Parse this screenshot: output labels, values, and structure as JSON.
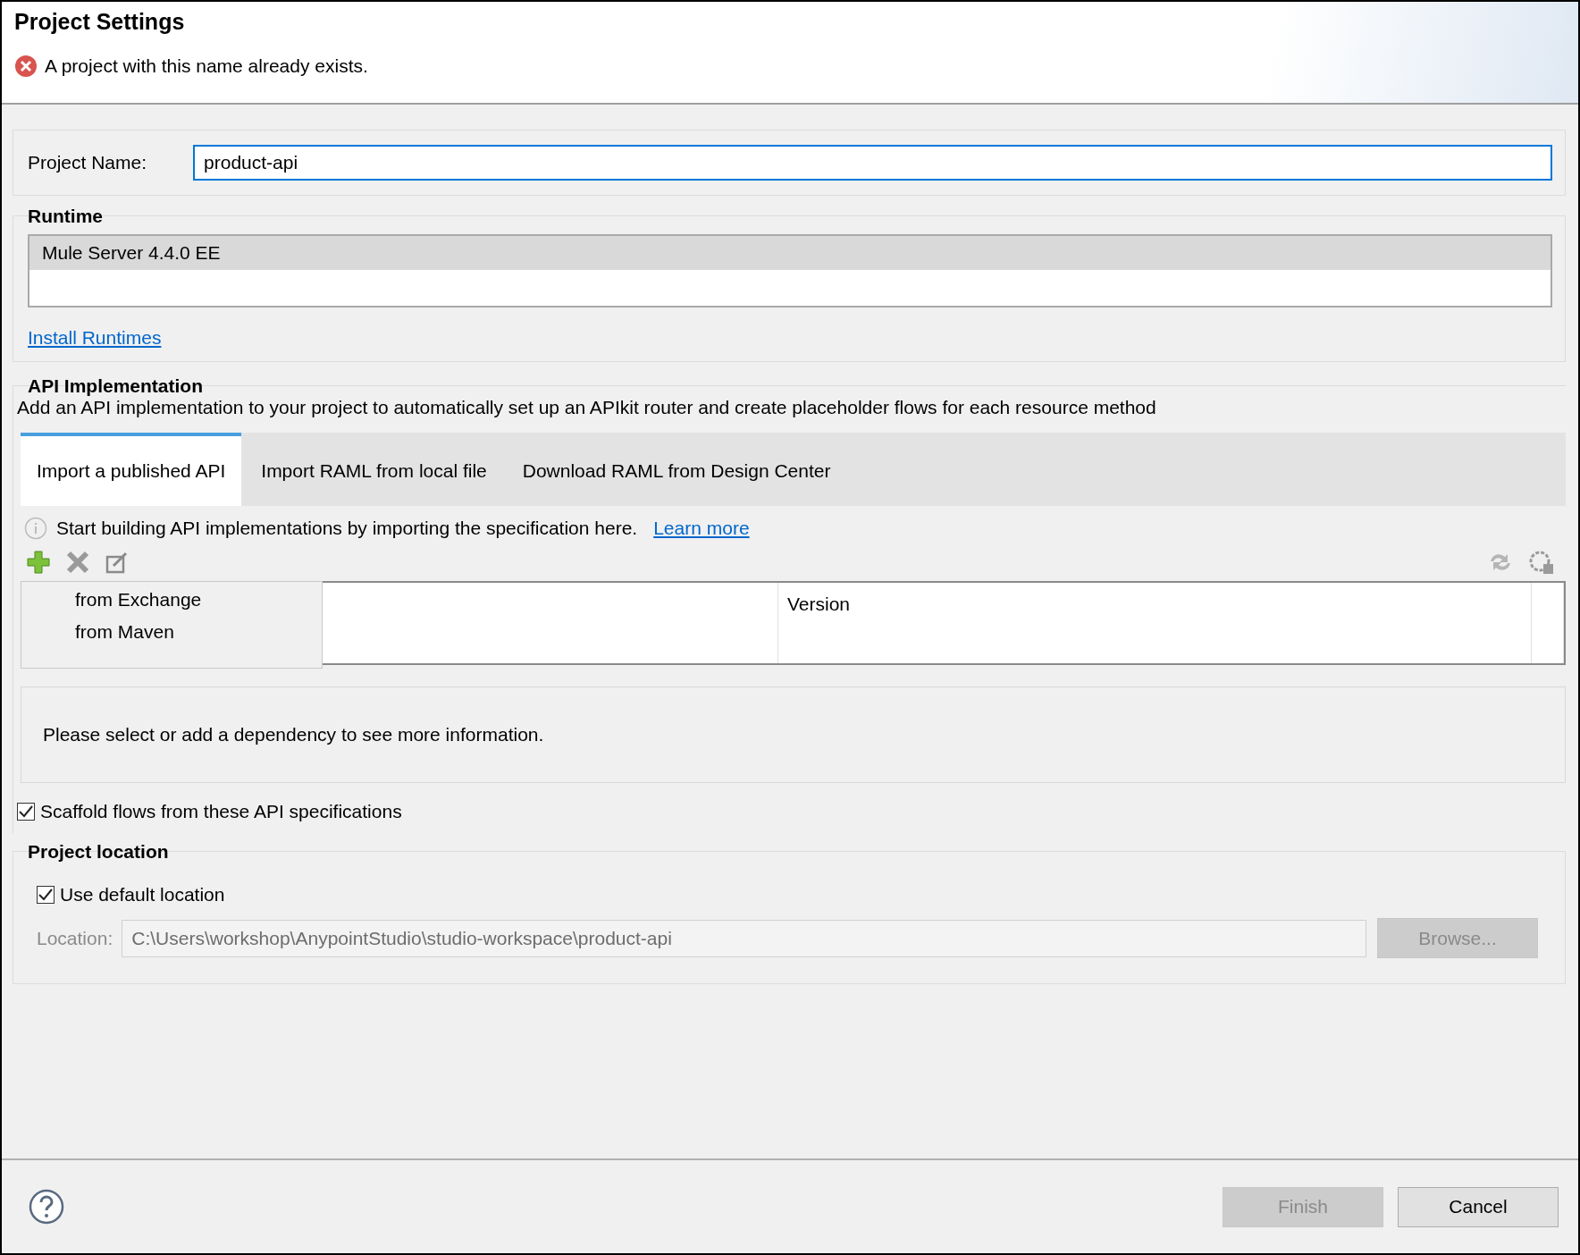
{
  "dialog": {
    "title": "Project Settings",
    "error": "A project with this name already exists."
  },
  "project_name": {
    "label": "Project Name:",
    "value": "product-api"
  },
  "runtime": {
    "title": "Runtime",
    "items": [
      {
        "label": "Mule Server 4.4.0 EE",
        "selected": true
      }
    ],
    "link": "Install Runtimes"
  },
  "api_implementation": {
    "title": "API Implementation",
    "description": "Add an API implementation to your project to automatically set up an APIkit router and create placeholder flows for each resource method",
    "tabs": [
      {
        "label": "Import a published API",
        "selected": true
      },
      {
        "label": "Import RAML from local file",
        "selected": false
      },
      {
        "label": "Download RAML from Design Center",
        "selected": false
      }
    ],
    "info": {
      "text": "Start building API implementations by importing the specification here.",
      "link": "Learn more"
    },
    "table": {
      "columns": [
        "Version"
      ]
    },
    "menu": {
      "items": [
        "from Exchange",
        "from Maven"
      ]
    },
    "details": "Please select or add a dependency to see more information.",
    "scaffold": {
      "label": "Scaffold flows from these API specifications",
      "checked": true
    }
  },
  "project_location": {
    "title": "Project location",
    "use_default": {
      "label": "Use default location",
      "checked": true
    },
    "location": {
      "label": "Location:",
      "value": "C:\\Users\\workshop\\AnypointStudio\\studio-workspace\\product-api",
      "disabled": true
    },
    "browse": {
      "label": "Browse...",
      "disabled": true
    }
  },
  "buttons": [
    {
      "label": "Finish",
      "disabled": true
    },
    {
      "label": "Cancel",
      "disabled": false
    }
  ]
}
